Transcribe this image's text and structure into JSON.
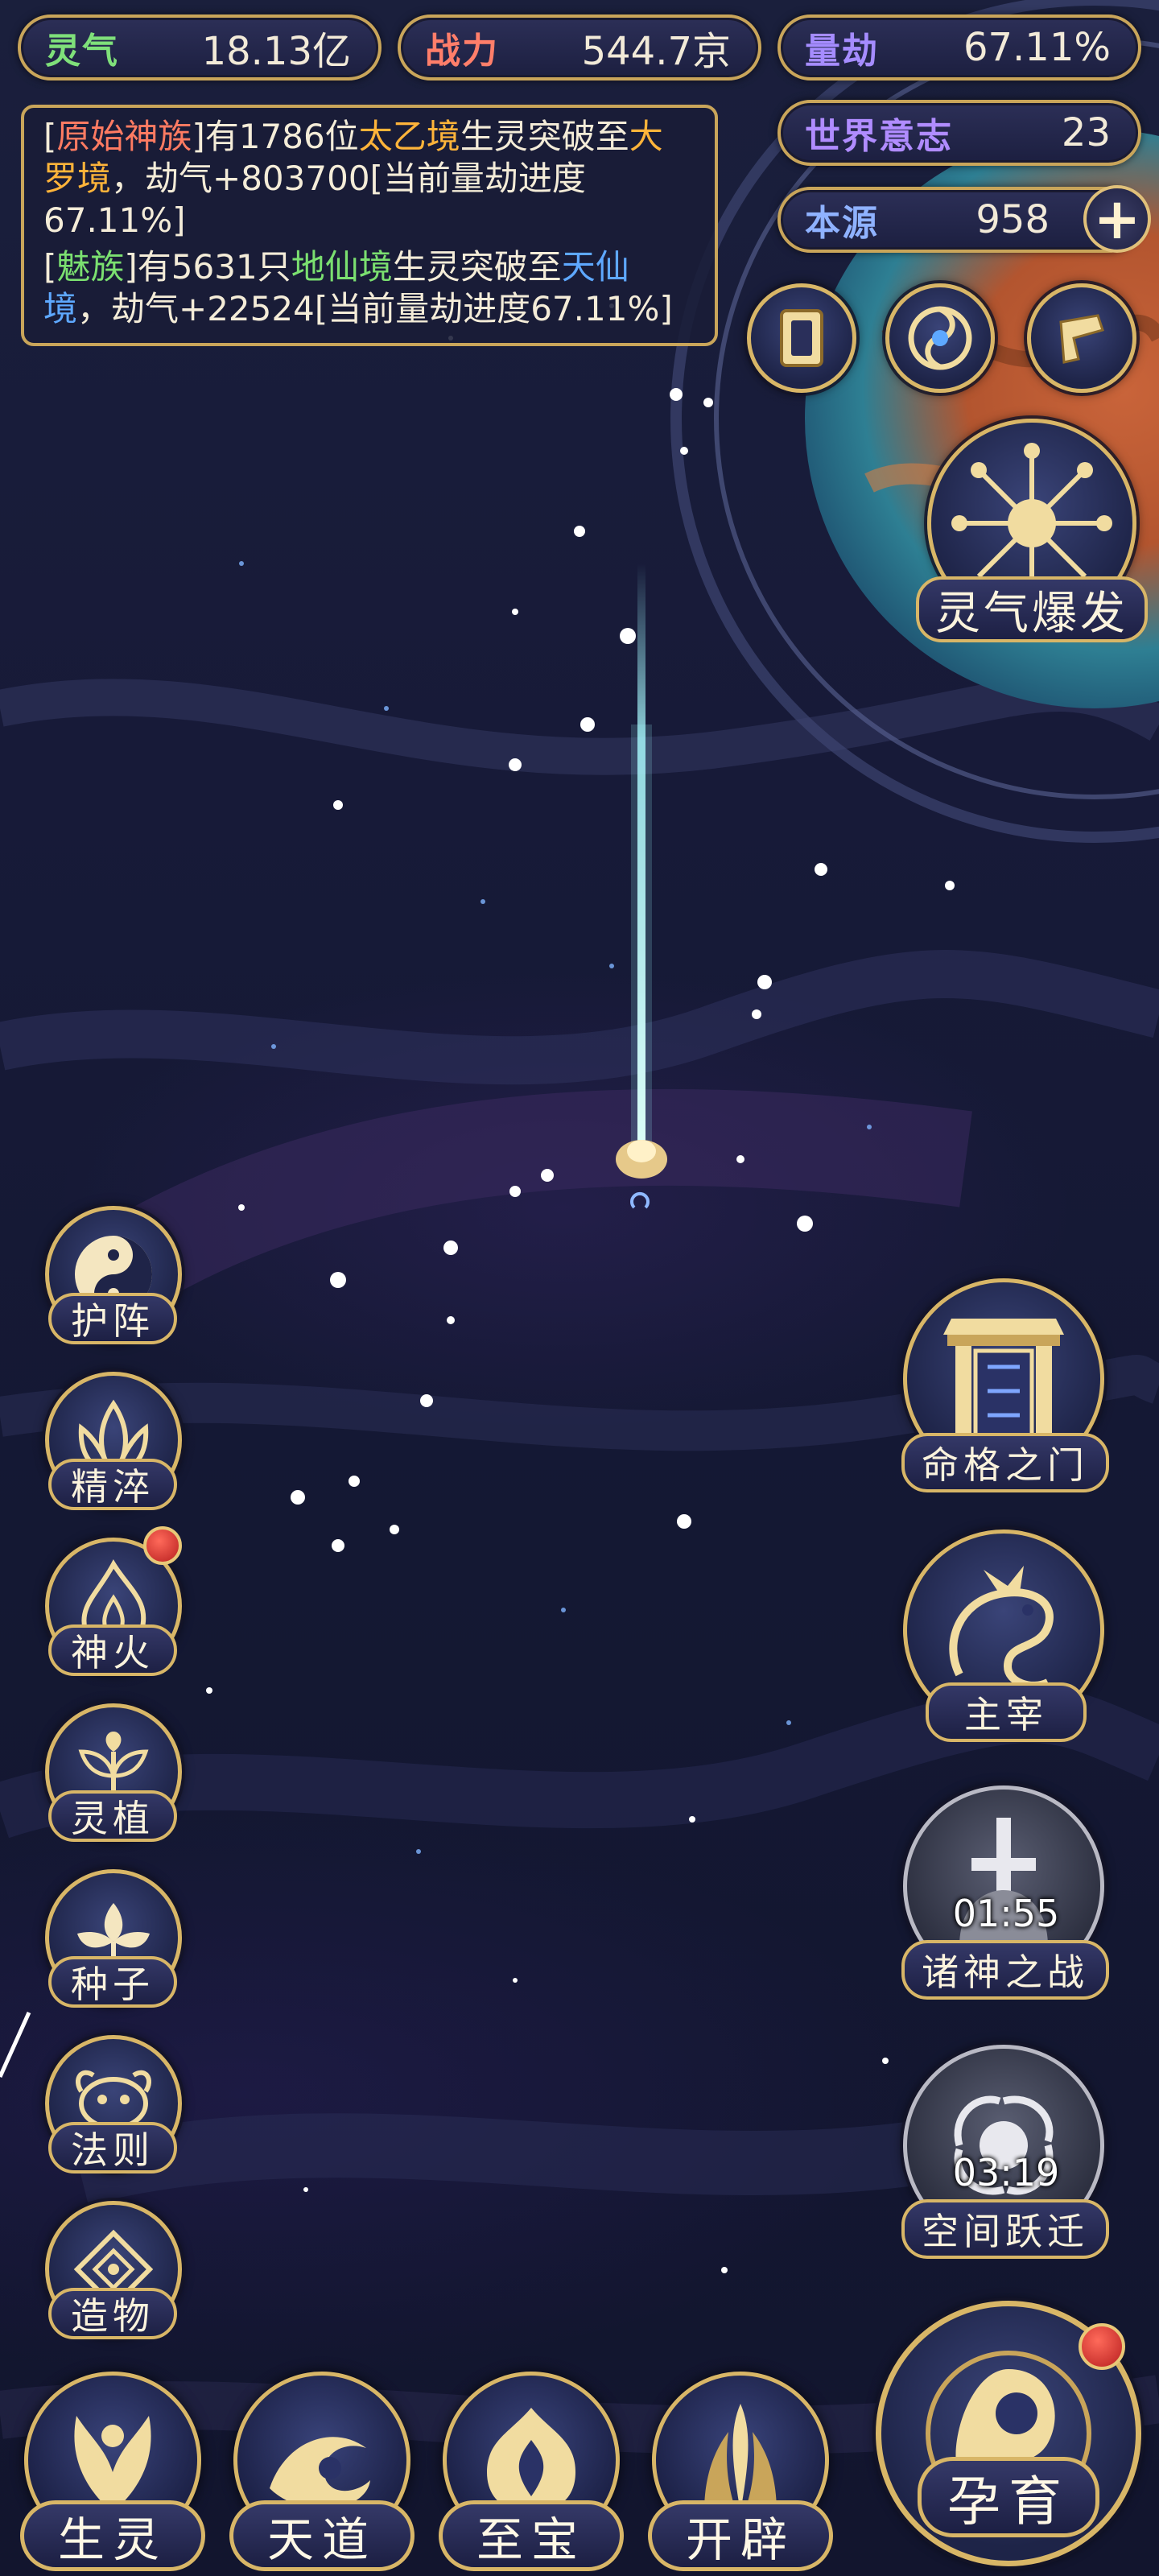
{
  "stats": {
    "lingqi": {
      "label": "灵气",
      "value": "18.13亿"
    },
    "zhanli": {
      "label": "战力",
      "value": "544.7京"
    },
    "liangjie": {
      "label": "量劫",
      "value": "67.11%"
    },
    "shijie_yizhi": {
      "label": "世界意志",
      "value": "23"
    },
    "benyuan": {
      "label": "本源",
      "value": "958"
    }
  },
  "log": {
    "msg1": {
      "b1": "[",
      "race": "原始神族",
      "b2": "]有1786位",
      "from_realm": "太乙境",
      "mid": "生灵突破至",
      "to_realm": "大罗境",
      "tail": "，劫气+803700[当前量劫进度67.11%]"
    },
    "msg2": {
      "b1": "[",
      "race": "魅族",
      "b2": "]有5631只",
      "from_realm": "地仙境",
      "mid": "生灵突破至",
      "to_realm": "天仙境",
      "tail": "，劫气+22524[当前量劫进度67.11%]"
    }
  },
  "top_right": {
    "burst_label": "灵气爆发"
  },
  "left_menu": [
    {
      "label": "护阵",
      "icon": "taiji-icon"
    },
    {
      "label": "精淬",
      "icon": "lotus-flame-icon"
    },
    {
      "label": "神火",
      "icon": "fire-icon",
      "badge": true
    },
    {
      "label": "灵植",
      "icon": "plant-icon"
    },
    {
      "label": "种子",
      "icon": "seed-icon"
    },
    {
      "label": "法则",
      "icon": "rule-beast-icon"
    },
    {
      "label": "造物",
      "icon": "creation-icon"
    }
  ],
  "right_menu": {
    "mingge": {
      "label": "命格之门"
    },
    "zhuzai": {
      "label": "主宰"
    },
    "zhushen": {
      "label": "诸神之战",
      "timer": "01:55"
    },
    "kongjian": {
      "label": "空间跃迁",
      "timer": "03:19"
    }
  },
  "bottom_nav": [
    {
      "label": "生灵",
      "icon": "phoenix-icon"
    },
    {
      "label": "天道",
      "icon": "wave-icon"
    },
    {
      "label": "至宝",
      "icon": "treasure-icon"
    },
    {
      "label": "开辟",
      "icon": "flame-pillar-icon"
    }
  ],
  "yunyu": {
    "label": "孕育"
  },
  "colors": {
    "gold": "#d8b667",
    "lingqi": "#7fe07a",
    "zhanli": "#ff7e6a",
    "liangjie": "#a58cff",
    "benyuan": "#8fb2ff",
    "race_red": "#ff7b62",
    "realm_orange": "#ffb43a",
    "realm_green": "#7be070",
    "realm_blue": "#5ea8ff",
    "badge_red": "#d62a2a"
  }
}
